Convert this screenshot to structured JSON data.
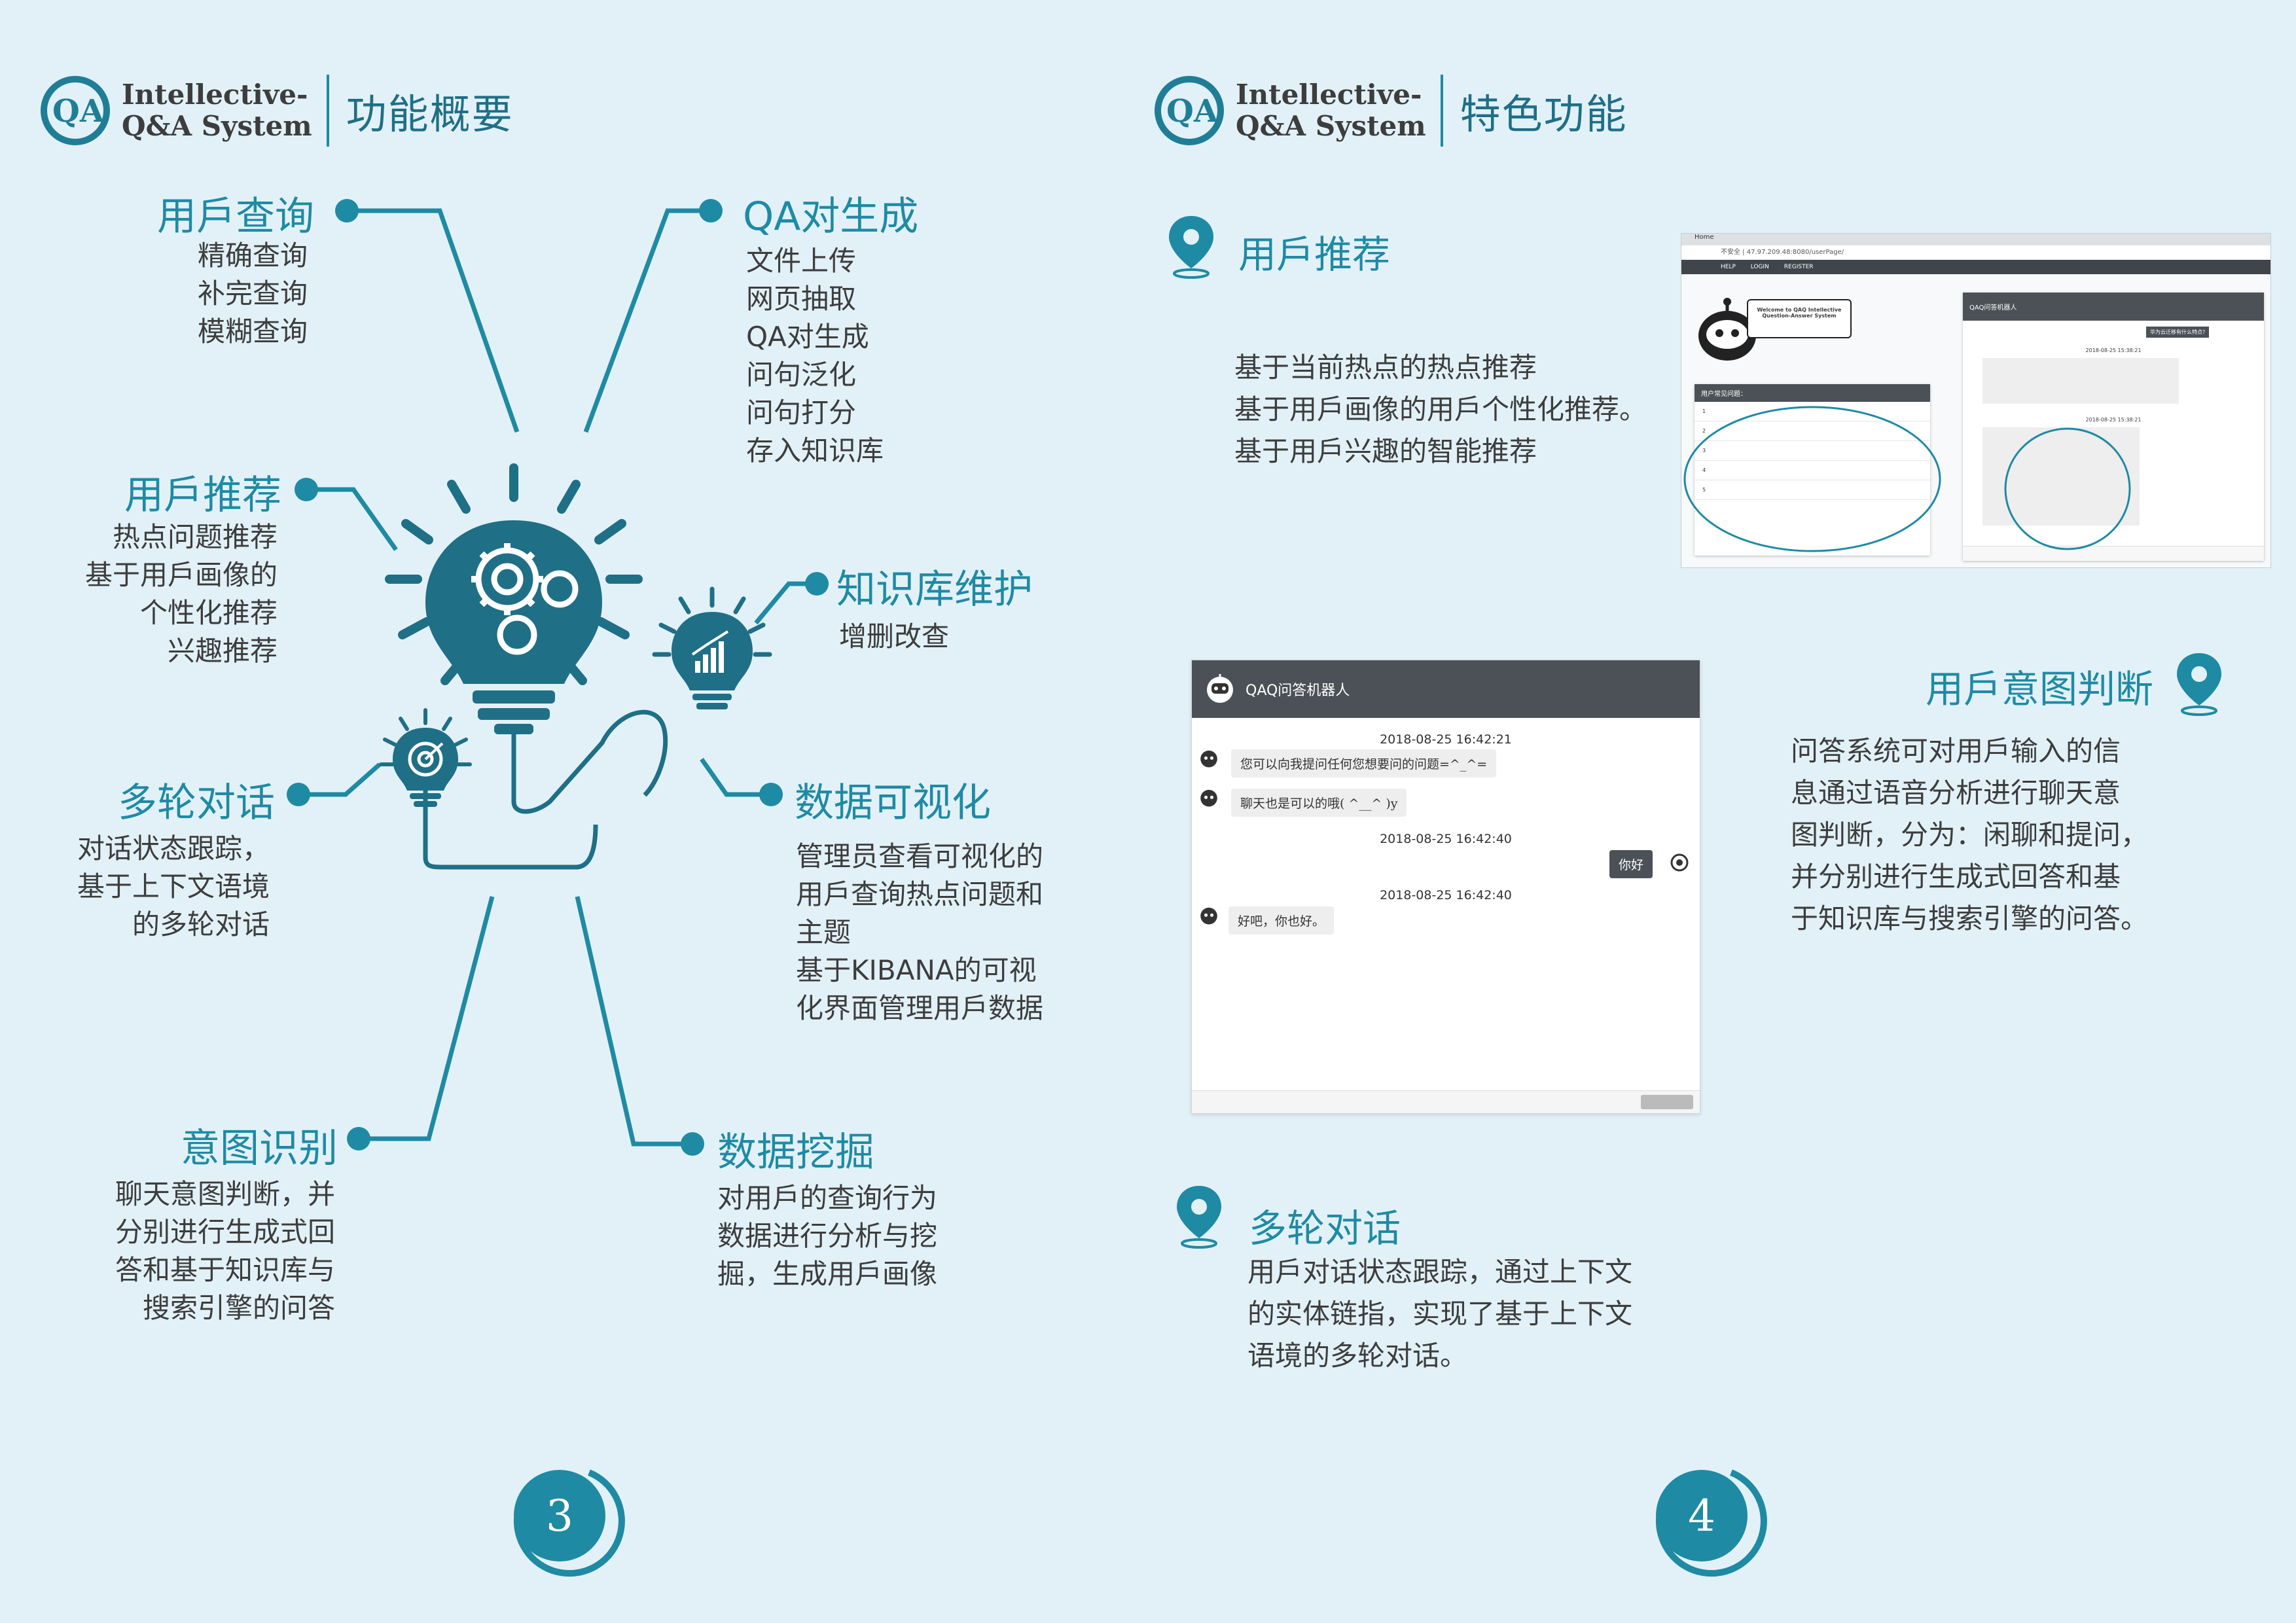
{
  "logo": {
    "line1": "Intellective-",
    "line2": "Q&A  System"
  },
  "left_page": {
    "section_title": "功能概要",
    "page_number": "3",
    "features": [
      {
        "id": "user-query",
        "title": "用戶查询",
        "items": "精确查询\n补完查询\n模糊查询"
      },
      {
        "id": "qa-generation",
        "title": "QA对生成",
        "items": "文件上传\n网页抽取\nQA对生成\n问句泛化\n问句打分\n存入知识库"
      },
      {
        "id": "user-recommend",
        "title": "用戶推荐",
        "items": "热点问题推荐\n基于用戶画像的\n个性化推荐\n兴趣推荐"
      },
      {
        "id": "kb-maintenance",
        "title": "知识库维护",
        "items": "增删改查"
      },
      {
        "id": "multi-turn",
        "title": "多轮对话",
        "items": "对话状态跟踪，\n基于上下文语境\n的多轮对话"
      },
      {
        "id": "data-visualization",
        "title": "数据可视化",
        "items": "管理员查看可视化的\n用戶查询热点问题和\n主题\n基于KIBANA的可视\n化界面管理用戶数据"
      },
      {
        "id": "intent-recognition",
        "title": "意图识别",
        "items": "聊天意图判断，并\n分别进行生成式回\n答和基于知识库与\n搜索引擎的问答"
      },
      {
        "id": "data-mining",
        "title": "数据挖掘",
        "items": "对用戶的查询行为\n数据进行分析与挖\n掘，生成用戶画像"
      }
    ]
  },
  "right_page": {
    "section_title": "特色功能",
    "page_number": "4",
    "sections": [
      {
        "id": "recommend",
        "title": "用戶推荐",
        "lines": [
          "基于当前热点的热点推荐",
          "基于用戶画像的用戶个性化推荐。",
          "基于用戶兴趣的智能推荐"
        ]
      },
      {
        "id": "intent",
        "title": "用戶意图判断",
        "lines": [
          "问答系统可对用戶输入的信",
          "息通过语音分析进行聊天意",
          "图判断，分为：闲聊和提问，",
          "并分别进行生成式回答和基",
          "于知识库与搜索引擎的问答。"
        ]
      },
      {
        "id": "multi-turn",
        "title": "多轮对话",
        "lines": [
          "用戶对话状态跟踪，通过上下文",
          "的实体链指，实现了基于上下文",
          "语境的多轮对话。"
        ]
      }
    ],
    "chat_window": {
      "title": "QAQ问答机器人",
      "messages": [
        {
          "time": "2018-08-25 16:42:21",
          "text": "您可以向我提问任何您想要问的问题=^_^="
        },
        {
          "text": "聊天也是可以的哦( ^__^ )y"
        },
        {
          "time": "2018-08-25 16:42:40",
          "text": "你好",
          "from_user": true
        },
        {
          "time": "2018-08-25 16:42:40",
          "text": "好吧，你也好。"
        }
      ]
    },
    "browser_shot": {
      "tab": "Home",
      "address": "不安全 | 47.97.209.48:8080/userPage/",
      "nav": [
        "HELP",
        "LOGIN",
        "REGISTER"
      ],
      "welcome": "Welcome to QAQ Intellective Question-Answer System",
      "faq_title": "用户常见问题：",
      "faq_items": [
        "1",
        "2",
        "3",
        "4",
        "5"
      ],
      "chat_title": "QAQ问答机器人",
      "user_question": "华为云迁移有什么特点?",
      "times": [
        "2018-08-25 15:38:21",
        "2018-08-25 15:38:21"
      ]
    }
  }
}
